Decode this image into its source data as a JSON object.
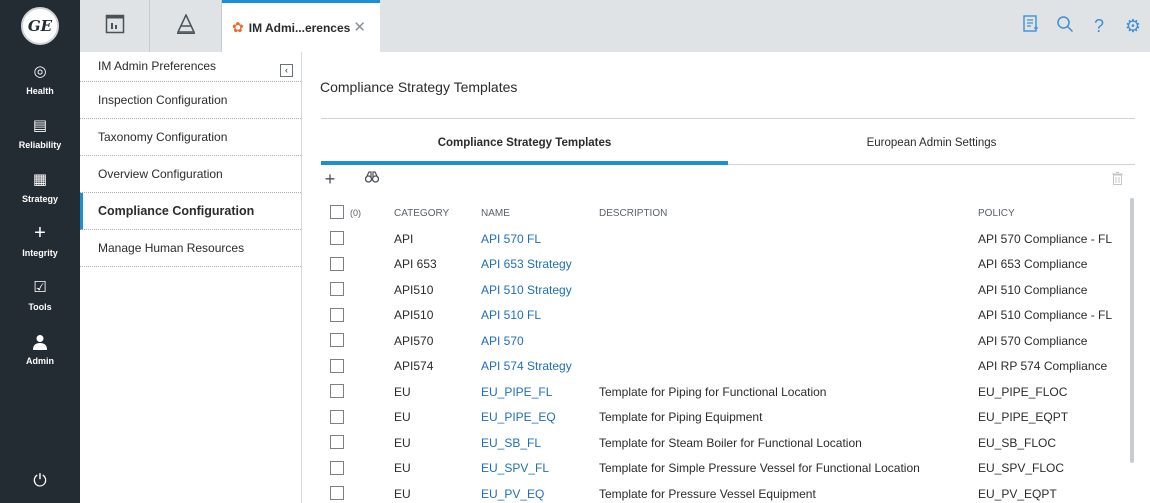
{
  "rail": {
    "items": [
      {
        "label": "Health",
        "icon": "target-icon"
      },
      {
        "label": "Reliability",
        "icon": "document-icon"
      },
      {
        "label": "Strategy",
        "icon": "list-icon"
      },
      {
        "label": "Integrity",
        "icon": "plus-icon"
      },
      {
        "label": "Tools",
        "icon": "checkbox-icon"
      },
      {
        "label": "Admin",
        "icon": "person-icon"
      }
    ]
  },
  "topbar": {
    "active_tab_label": "IM Admi...erences"
  },
  "menu": {
    "header": "IM Admin Preferences",
    "items": [
      {
        "label": "Inspection Configuration"
      },
      {
        "label": "Taxonomy Configuration"
      },
      {
        "label": "Overview Configuration"
      },
      {
        "label": "Compliance Configuration"
      },
      {
        "label": "Manage Human Resources"
      }
    ]
  },
  "main": {
    "title": "Compliance Strategy Templates",
    "tabs": [
      {
        "label": "Compliance Strategy Templates"
      },
      {
        "label": "European Admin Settings"
      }
    ],
    "grid": {
      "selected_count": "(0)",
      "columns": {
        "category": "CATEGORY",
        "name": "NAME",
        "description": "DESCRIPTION",
        "policy": "POLICY"
      },
      "rows": [
        {
          "category": "API",
          "name": "API 570 FL",
          "description": "",
          "policy": "API 570 Compliance - FL"
        },
        {
          "category": "API 653",
          "name": "API 653 Strategy",
          "description": "",
          "policy": "API 653 Compliance"
        },
        {
          "category": "API510",
          "name": "API 510 Strategy",
          "description": "",
          "policy": "API 510 Compliance"
        },
        {
          "category": "API510",
          "name": "API 510 FL",
          "description": "",
          "policy": "API 510 Compliance - FL"
        },
        {
          "category": "API570",
          "name": "API 570",
          "description": "",
          "policy": "API 570 Compliance"
        },
        {
          "category": "API574",
          "name": "API 574 Strategy",
          "description": "",
          "policy": "API RP 574 Compliance"
        },
        {
          "category": "EU",
          "name": "EU_PIPE_FL",
          "description": "Template for Piping for Functional Location",
          "policy": "EU_PIPE_FLOC"
        },
        {
          "category": "EU",
          "name": "EU_PIPE_EQ",
          "description": "Template for Piping Equipment",
          "policy": "EU_PIPE_EQPT"
        },
        {
          "category": "EU",
          "name": "EU_SB_FL",
          "description": "Template for Steam Boiler for Functional Location",
          "policy": "EU_SB_FLOC"
        },
        {
          "category": "EU",
          "name": "EU_SPV_FL",
          "description": "Template for Simple Pressure Vessel for Functional Location",
          "policy": "EU_SPV_FLOC"
        },
        {
          "category": "EU",
          "name": "EU_PV_EQ",
          "description": "Template for Pressure Vessel Equipment",
          "policy": "EU_PV_EQPT"
        }
      ]
    }
  }
}
